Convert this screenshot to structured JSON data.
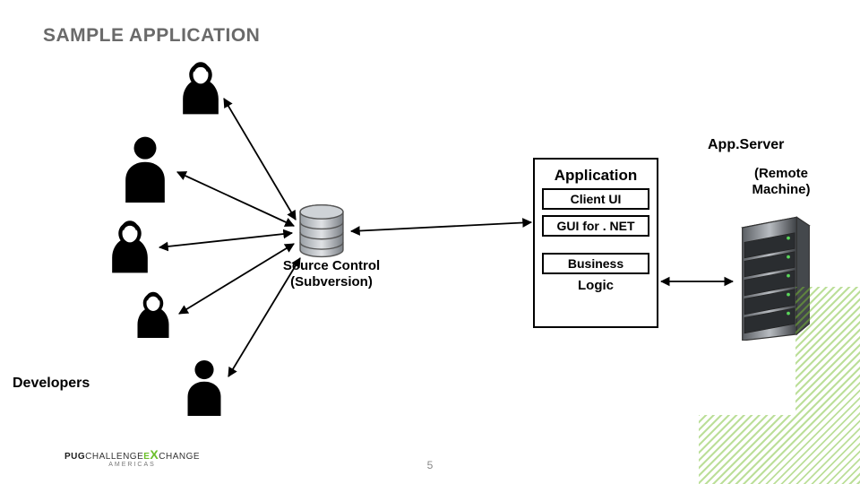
{
  "title": "SAMPLE APPLICATION",
  "labels": {
    "developers": "Developers",
    "source_control_l1": "Source Control",
    "source_control_l2": "(Subversion)",
    "appserver": "App.Server",
    "remote_l1": "(Remote",
    "remote_l2": "Machine)"
  },
  "application": {
    "title": "Application",
    "client_ui": "Client UI",
    "gui_net": "GUI for . NET",
    "business": "Business",
    "logic": "Logic"
  },
  "footer": {
    "logo_main_1": "PUG",
    "logo_main_2": "CHALLENGE",
    "logo_exchange": "E",
    "logo_xchange": "CHANGE",
    "logo_sub": "AMERICAS"
  },
  "page_number": "5"
}
